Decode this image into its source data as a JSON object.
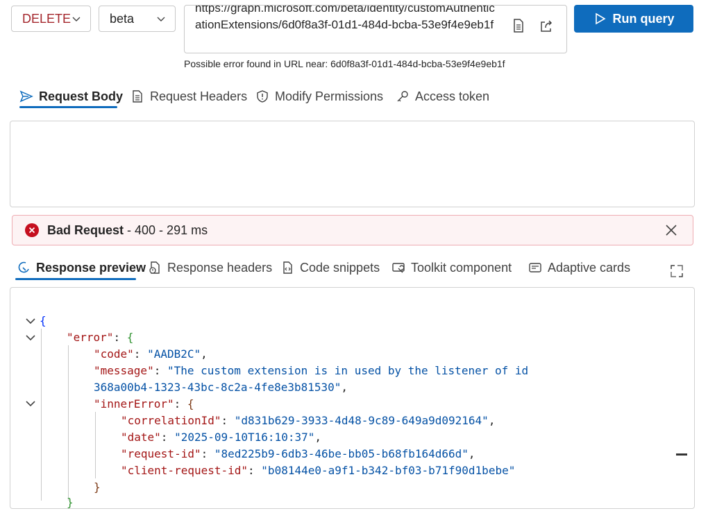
{
  "request": {
    "method": "DELETE",
    "version": "beta",
    "url": "https://graph.microsoft.com/beta/identity/customAuthenticationExtensions/6d0f8a3f-01d1-484d-bcba-53e9f4e9eb1f",
    "url_error": "Possible error found in URL near: 6d0f8a3f-01d1-484d-bcba-53e9f4e9eb1f",
    "run_label": "Run query"
  },
  "request_tabs": [
    {
      "label": "Request Body",
      "icon": "send-icon",
      "active": true
    },
    {
      "label": "Request Headers",
      "icon": "document-icon",
      "active": false
    },
    {
      "label": "Modify Permissions",
      "icon": "shield-icon",
      "active": false
    },
    {
      "label": "Access token",
      "icon": "key-icon",
      "active": false
    }
  ],
  "status": {
    "title": "Bad Request",
    "detail": " - 400 - 291 ms",
    "color": "#c50f1f"
  },
  "response_tabs": [
    {
      "label": "Response preview",
      "icon": "preview-icon",
      "active": true
    },
    {
      "label": "Response headers",
      "icon": "document-icon",
      "active": false
    },
    {
      "label": "Code snippets",
      "icon": "code-icon",
      "active": false
    },
    {
      "label": "Toolkit component",
      "icon": "toolkit-icon",
      "active": false
    },
    {
      "label": "Adaptive cards",
      "icon": "card-icon",
      "active": false
    }
  ],
  "response": {
    "error_key": "\"error\"",
    "code_key": "\"code\"",
    "code_value": "\"AADB2C\"",
    "message_key": "\"message\"",
    "message_value_line1": "\"The custom extension is in used by the listener of id",
    "message_value_line2": "368a00b4-1323-43bc-8c2a-4fe8e3b81530\"",
    "inner_error_key": "\"innerError\"",
    "correlation_key": "\"correlationId\"",
    "correlation_value": "\"d831b629-3933-4d48-9c89-649a9d092164\"",
    "date_key": "\"date\"",
    "date_value": "\"2025-09-10T16:10:37\"",
    "request_id_key": "\"request-id\"",
    "request_id_value": "\"8ed225b9-6db3-46be-bb05-b68fb164d66d\"",
    "client_request_id_key": "\"client-request-id\"",
    "client_request_id_value": "\"b08144e0-a9f1-b342-bf03-b71f90d1bebe\""
  },
  "colors": {
    "accent": "#0f6cbd",
    "error": "#c50f1f",
    "json_key": "#a31515",
    "json_string": "#0451a5"
  }
}
